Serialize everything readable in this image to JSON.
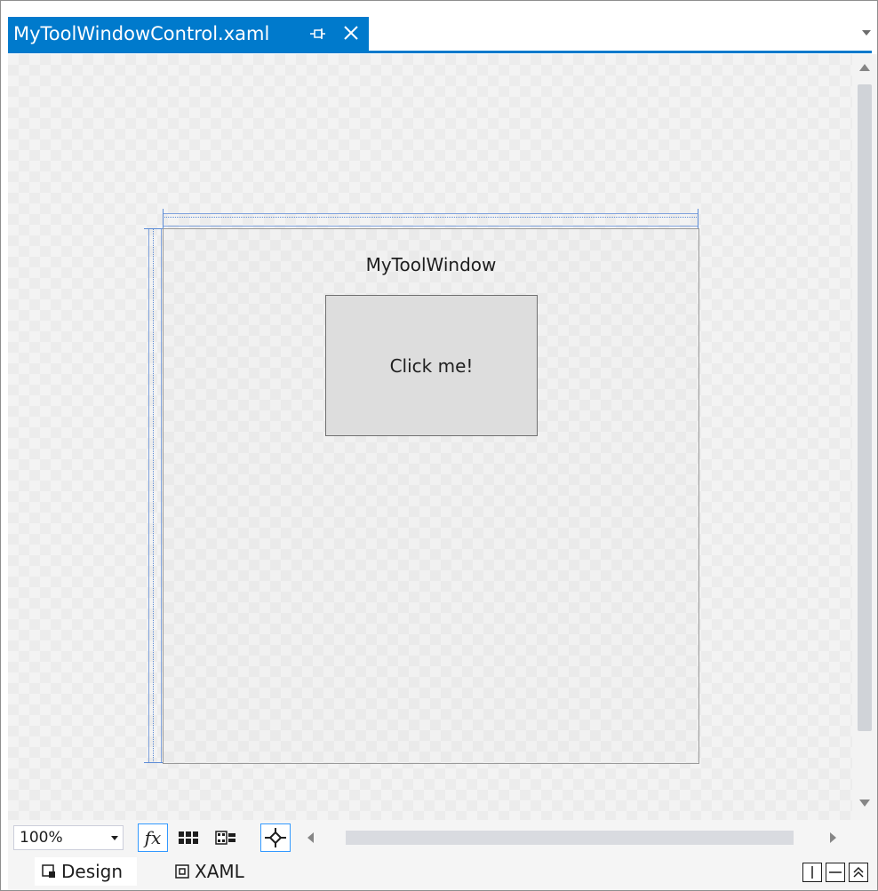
{
  "document_tab": {
    "title": "MyToolWindowControl.xaml",
    "pin_icon": "pin-icon",
    "close_icon": "close-icon"
  },
  "designer": {
    "user_control": {
      "title": "MyToolWindow",
      "button_label": "Click me!"
    }
  },
  "toolbar": {
    "zoom": "100%",
    "icons": [
      "fx-icon",
      "grid-icon",
      "artboard-background-icon",
      "snap-icon"
    ]
  },
  "views": {
    "design_label": "Design",
    "xaml_label": "XAML"
  },
  "colors": {
    "accent": "#007acc",
    "surface": "#f3f3f3",
    "button_face": "#dddddd"
  }
}
